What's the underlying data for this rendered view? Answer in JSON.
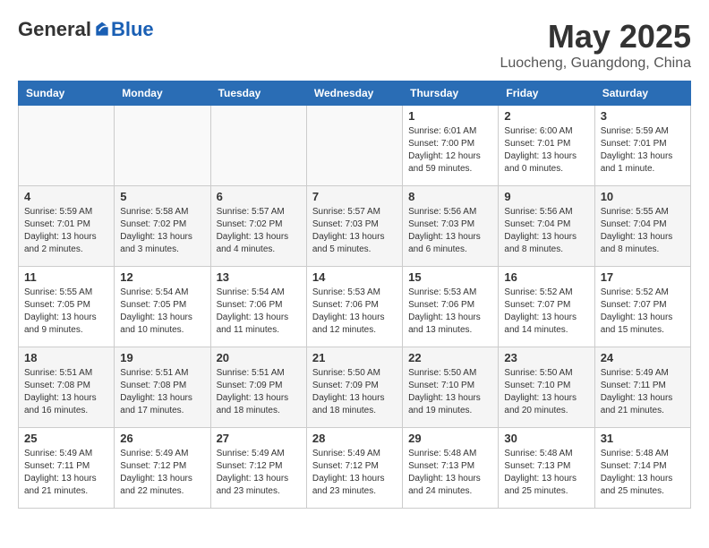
{
  "logo": {
    "general": "General",
    "blue": "Blue"
  },
  "title": {
    "month_year": "May 2025",
    "location": "Luocheng, Guangdong, China"
  },
  "weekdays": [
    "Sunday",
    "Monday",
    "Tuesday",
    "Wednesday",
    "Thursday",
    "Friday",
    "Saturday"
  ],
  "weeks": [
    [
      {
        "day": "",
        "info": ""
      },
      {
        "day": "",
        "info": ""
      },
      {
        "day": "",
        "info": ""
      },
      {
        "day": "",
        "info": ""
      },
      {
        "day": "1",
        "info": "Sunrise: 6:01 AM\nSunset: 7:00 PM\nDaylight: 12 hours and 59 minutes."
      },
      {
        "day": "2",
        "info": "Sunrise: 6:00 AM\nSunset: 7:01 PM\nDaylight: 13 hours and 0 minutes."
      },
      {
        "day": "3",
        "info": "Sunrise: 5:59 AM\nSunset: 7:01 PM\nDaylight: 13 hours and 1 minute."
      }
    ],
    [
      {
        "day": "4",
        "info": "Sunrise: 5:59 AM\nSunset: 7:01 PM\nDaylight: 13 hours and 2 minutes."
      },
      {
        "day": "5",
        "info": "Sunrise: 5:58 AM\nSunset: 7:02 PM\nDaylight: 13 hours and 3 minutes."
      },
      {
        "day": "6",
        "info": "Sunrise: 5:57 AM\nSunset: 7:02 PM\nDaylight: 13 hours and 4 minutes."
      },
      {
        "day": "7",
        "info": "Sunrise: 5:57 AM\nSunset: 7:03 PM\nDaylight: 13 hours and 5 minutes."
      },
      {
        "day": "8",
        "info": "Sunrise: 5:56 AM\nSunset: 7:03 PM\nDaylight: 13 hours and 6 minutes."
      },
      {
        "day": "9",
        "info": "Sunrise: 5:56 AM\nSunset: 7:04 PM\nDaylight: 13 hours and 8 minutes."
      },
      {
        "day": "10",
        "info": "Sunrise: 5:55 AM\nSunset: 7:04 PM\nDaylight: 13 hours and 8 minutes."
      }
    ],
    [
      {
        "day": "11",
        "info": "Sunrise: 5:55 AM\nSunset: 7:05 PM\nDaylight: 13 hours and 9 minutes."
      },
      {
        "day": "12",
        "info": "Sunrise: 5:54 AM\nSunset: 7:05 PM\nDaylight: 13 hours and 10 minutes."
      },
      {
        "day": "13",
        "info": "Sunrise: 5:54 AM\nSunset: 7:06 PM\nDaylight: 13 hours and 11 minutes."
      },
      {
        "day": "14",
        "info": "Sunrise: 5:53 AM\nSunset: 7:06 PM\nDaylight: 13 hours and 12 minutes."
      },
      {
        "day": "15",
        "info": "Sunrise: 5:53 AM\nSunset: 7:06 PM\nDaylight: 13 hours and 13 minutes."
      },
      {
        "day": "16",
        "info": "Sunrise: 5:52 AM\nSunset: 7:07 PM\nDaylight: 13 hours and 14 minutes."
      },
      {
        "day": "17",
        "info": "Sunrise: 5:52 AM\nSunset: 7:07 PM\nDaylight: 13 hours and 15 minutes."
      }
    ],
    [
      {
        "day": "18",
        "info": "Sunrise: 5:51 AM\nSunset: 7:08 PM\nDaylight: 13 hours and 16 minutes."
      },
      {
        "day": "19",
        "info": "Sunrise: 5:51 AM\nSunset: 7:08 PM\nDaylight: 13 hours and 17 minutes."
      },
      {
        "day": "20",
        "info": "Sunrise: 5:51 AM\nSunset: 7:09 PM\nDaylight: 13 hours and 18 minutes."
      },
      {
        "day": "21",
        "info": "Sunrise: 5:50 AM\nSunset: 7:09 PM\nDaylight: 13 hours and 18 minutes."
      },
      {
        "day": "22",
        "info": "Sunrise: 5:50 AM\nSunset: 7:10 PM\nDaylight: 13 hours and 19 minutes."
      },
      {
        "day": "23",
        "info": "Sunrise: 5:50 AM\nSunset: 7:10 PM\nDaylight: 13 hours and 20 minutes."
      },
      {
        "day": "24",
        "info": "Sunrise: 5:49 AM\nSunset: 7:11 PM\nDaylight: 13 hours and 21 minutes."
      }
    ],
    [
      {
        "day": "25",
        "info": "Sunrise: 5:49 AM\nSunset: 7:11 PM\nDaylight: 13 hours and 21 minutes."
      },
      {
        "day": "26",
        "info": "Sunrise: 5:49 AM\nSunset: 7:12 PM\nDaylight: 13 hours and 22 minutes."
      },
      {
        "day": "27",
        "info": "Sunrise: 5:49 AM\nSunset: 7:12 PM\nDaylight: 13 hours and 23 minutes."
      },
      {
        "day": "28",
        "info": "Sunrise: 5:49 AM\nSunset: 7:12 PM\nDaylight: 13 hours and 23 minutes."
      },
      {
        "day": "29",
        "info": "Sunrise: 5:48 AM\nSunset: 7:13 PM\nDaylight: 13 hours and 24 minutes."
      },
      {
        "day": "30",
        "info": "Sunrise: 5:48 AM\nSunset: 7:13 PM\nDaylight: 13 hours and 25 minutes."
      },
      {
        "day": "31",
        "info": "Sunrise: 5:48 AM\nSunset: 7:14 PM\nDaylight: 13 hours and 25 minutes."
      }
    ]
  ]
}
